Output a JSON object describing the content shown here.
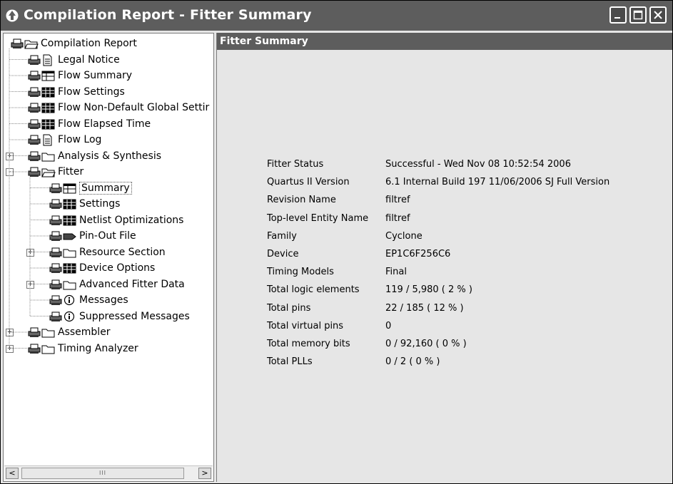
{
  "window": {
    "title": "Compilation Report - Fitter Summary"
  },
  "tree": [
    {
      "label": "Compilation Report",
      "icon": "folder-open-icon",
      "level": 0,
      "expander": ""
    },
    {
      "label": "Legal Notice",
      "icon": "document-icon",
      "level": 1,
      "expander": ""
    },
    {
      "label": "Flow Summary",
      "icon": "table-icon",
      "level": 1,
      "expander": ""
    },
    {
      "label": "Flow Settings",
      "icon": "grid-icon",
      "level": 1,
      "expander": ""
    },
    {
      "label": "Flow Non-Default Global Settir",
      "icon": "grid-icon",
      "level": 1,
      "expander": ""
    },
    {
      "label": "Flow Elapsed Time",
      "icon": "grid-icon",
      "level": 1,
      "expander": ""
    },
    {
      "label": "Flow Log",
      "icon": "document-icon",
      "level": 1,
      "expander": ""
    },
    {
      "label": "Analysis & Synthesis",
      "icon": "folder-icon",
      "level": 1,
      "expander": "+"
    },
    {
      "label": "Fitter",
      "icon": "folder-open-icon",
      "level": 1,
      "expander": "-"
    },
    {
      "label": "Summary",
      "icon": "table-icon",
      "level": 2,
      "expander": "",
      "selected": true
    },
    {
      "label": "Settings",
      "icon": "grid-icon",
      "level": 2,
      "expander": ""
    },
    {
      "label": "Netlist Optimizations",
      "icon": "grid-icon",
      "level": 2,
      "expander": ""
    },
    {
      "label": "Pin-Out File",
      "icon": "pin-icon",
      "level": 2,
      "expander": ""
    },
    {
      "label": "Resource Section",
      "icon": "folder-icon",
      "level": 2,
      "expander": "+"
    },
    {
      "label": "Device Options",
      "icon": "grid-icon",
      "level": 2,
      "expander": ""
    },
    {
      "label": "Advanced Fitter Data",
      "icon": "folder-icon",
      "level": 2,
      "expander": "+"
    },
    {
      "label": "Messages",
      "icon": "info-icon",
      "level": 2,
      "expander": ""
    },
    {
      "label": "Suppressed Messages",
      "icon": "info-icon",
      "level": 2,
      "expander": ""
    },
    {
      "label": "Assembler",
      "icon": "folder-icon",
      "level": 1,
      "expander": "+"
    },
    {
      "label": "Timing Analyzer",
      "icon": "folder-icon",
      "level": 1,
      "expander": "+"
    }
  ],
  "panel": {
    "header": "Fitter Summary",
    "rows": [
      {
        "key": "Fitter Status",
        "value": "Successful - Wed Nov 08 10:52:54 2006"
      },
      {
        "key": "Quartus II Version",
        "value": "6.1 Internal Build 197 11/06/2006 SJ Full Version"
      },
      {
        "key": "Revision Name",
        "value": "filtref"
      },
      {
        "key": "Top-level Entity Name",
        "value": "filtref"
      },
      {
        "key": "Family",
        "value": "Cyclone"
      },
      {
        "key": "Device",
        "value": "EP1C6F256C6"
      },
      {
        "key": "Timing Models",
        "value": "Final"
      },
      {
        "key": "Total logic elements",
        "value": "119 / 5,980 ( 2 % )"
      },
      {
        "key": "Total pins",
        "value": "22 / 185 ( 12 % )"
      },
      {
        "key": "Total virtual pins",
        "value": "0"
      },
      {
        "key": "Total memory bits",
        "value": "0 / 92,160 ( 0 % )"
      },
      {
        "key": "Total PLLs",
        "value": "0 / 2 ( 0 % )"
      }
    ]
  },
  "scrollbar": {
    "left_arrow": "<",
    "right_arrow": ">",
    "grip": "III"
  }
}
